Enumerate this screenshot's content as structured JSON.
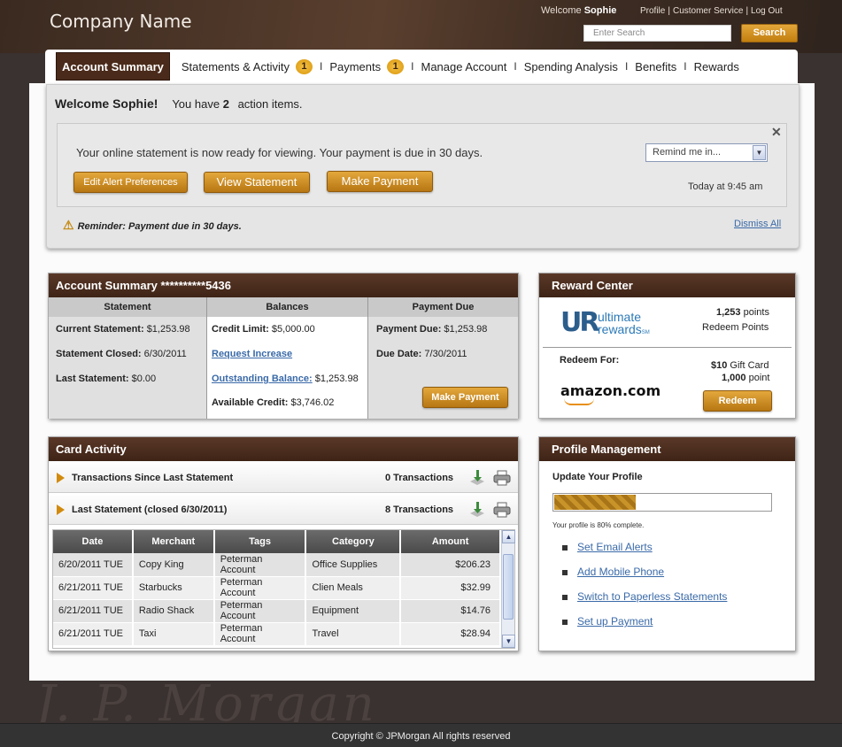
{
  "header": {
    "company": "Company Name",
    "welcome_prefix": "Welcome",
    "user": "Sophie",
    "links": [
      "Profile",
      "Customer Service",
      "Log Out"
    ],
    "search_placeholder": "Enter Search",
    "search_button": "Search"
  },
  "nav": {
    "tabs": [
      {
        "label": "Account Summary",
        "active": true
      },
      {
        "label": "Statements & Activity",
        "badge": "1"
      },
      {
        "label": "Payments",
        "badge": "1"
      },
      {
        "label": "Manage Account"
      },
      {
        "label": "Spending Analysis"
      },
      {
        "label": "Benefits"
      },
      {
        "label": "Rewards"
      }
    ]
  },
  "welcome_panel": {
    "greeting": "Welcome Sophie!",
    "action_prefix": "You have",
    "action_count": "2",
    "action_suffix": "action items.",
    "alert_message": "Your online statement is now ready for viewing. Your payment is due in 30 days.",
    "remind_select": "Remind me in...",
    "timestamp": "Today at 9:45 am",
    "buttons": {
      "edit_alerts": "Edit Alert Preferences",
      "view_statement": "View Statement",
      "make_payment": "Make Payment"
    },
    "reminder": "Reminder: Payment due in 30 days.",
    "dismiss": "Dismiss All"
  },
  "account_summary": {
    "title": "Account Summary **********5436",
    "statement": {
      "header": "Statement",
      "current_label": "Current Statement:",
      "current_value": "$1,253.98",
      "closed_label": "Statement Closed:",
      "closed_value": "6/30/2011",
      "last_label": "Last Statement:",
      "last_value": "$0.00"
    },
    "balances": {
      "header": "Balances",
      "credit_limit_label": "Credit Limit:",
      "credit_limit_value": "$5,000.00",
      "request_increase": "Request Increase",
      "outstanding_label": "Outstanding Balance:",
      "outstanding_value": "$1,253.98",
      "available_label": "Available Credit:",
      "available_value": "$3,746.02"
    },
    "payment_due": {
      "header": "Payment Due",
      "due_label": "Payment Due:",
      "due_value": "$1,253.98",
      "date_label": "Due Date:",
      "date_value": "7/30/2011",
      "button": "Make Payment"
    }
  },
  "reward_center": {
    "title": "Reward Center",
    "logo_letters": "UR",
    "logo_line1": "ultimate",
    "logo_line2": "rewards",
    "logo_mark": "SM",
    "points_value": "1,253",
    "points_label": "points",
    "redeem_points": "Redeem Points",
    "redeem_for": "Redeem For:",
    "vendor": "amazon.com",
    "gift_value": "$10",
    "gift_label": "Gift Card",
    "gift_points": "1,000",
    "gift_points_label": "point",
    "redeem_button": "Redeem"
  },
  "card_activity": {
    "title": "Card Activity",
    "sections": [
      {
        "label": "Transactions Since Last Statement",
        "count": "0 Transactions"
      },
      {
        "label": "Last Statement (closed 6/30/2011)",
        "count": "8 Transactions"
      }
    ],
    "columns": [
      "Date",
      "Merchant",
      "Tags",
      "Category",
      "Amount"
    ],
    "rows": [
      [
        "6/20/2011 TUE",
        "Copy King",
        "Peterman Account",
        "Office Supplies",
        "$206.23"
      ],
      [
        "6/21/2011 TUE",
        "Starbucks",
        "Peterman Account",
        "Clien Meals",
        "$32.99"
      ],
      [
        "6/21/2011 TUE",
        "Radio Shack",
        "Peterman Account",
        "Equipment",
        "$14.76"
      ],
      [
        "6/21/2011 TUE",
        "Taxi",
        "Peterman Account",
        "Travel",
        "$28.94"
      ]
    ]
  },
  "profile_management": {
    "title": "Profile Management",
    "subtitle": "Update Your Profile",
    "progress": 0.375,
    "note": "Your profile is 80% complete.",
    "links": [
      "Set Email Alerts",
      "Add Mobile Phone",
      "Switch to Paperless Statements",
      "Set up Payment"
    ]
  },
  "footer": {
    "text": "Copyright © JPMorgan  All rights reserved"
  },
  "colors": {
    "brand_brown": "#4a2a1a",
    "accent_gold": "#d28a0c",
    "link_blue": "#3a6aa8"
  }
}
